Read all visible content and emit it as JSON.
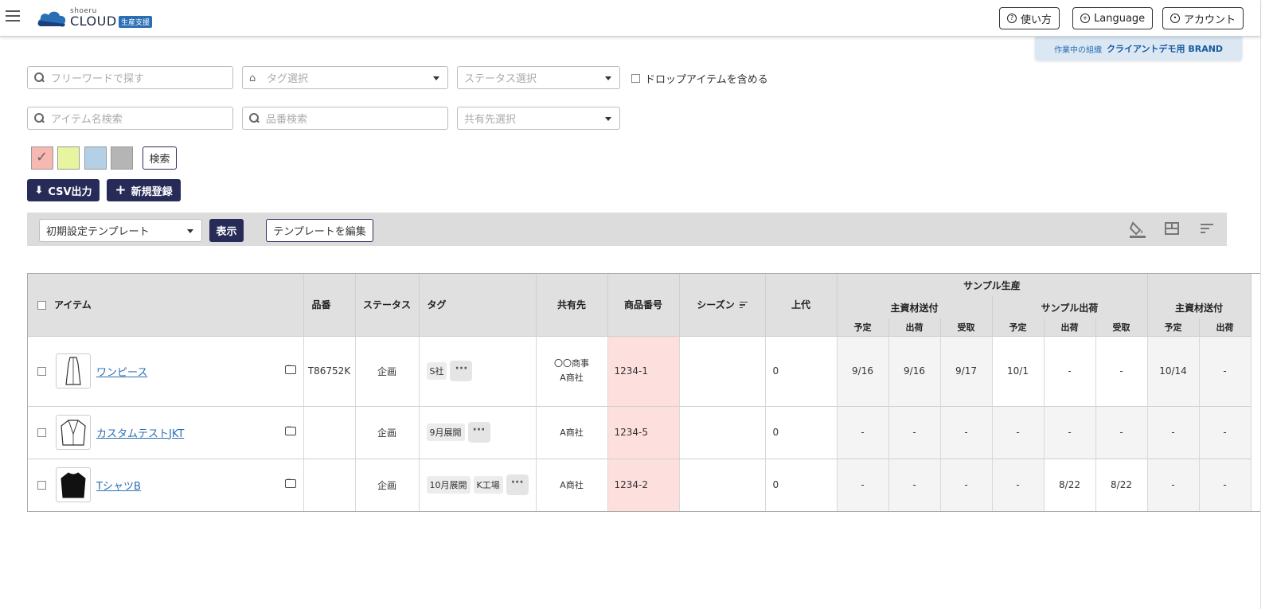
{
  "header": {
    "logo_small": "shoeru",
    "logo_big": "CLOUD",
    "logo_tag": "生産支援",
    "help_label": "使い方",
    "language_label": "Language",
    "account_label": "アカウント"
  },
  "org": {
    "prefix": "作業中の組織",
    "name": "クライアントデモ用 BRAND"
  },
  "filters": {
    "freeword_placeholder": "フリーワードで探す",
    "tag_placeholder": "タグ選択",
    "status_placeholder": "ステータス選択",
    "drop_label": "ドロップアイテムを含める",
    "itemname_placeholder": "アイテム名検索",
    "partno_placeholder": "品番検索",
    "share_placeholder": "共有先選択",
    "search_label": "検索",
    "swatches": [
      "#f7b8b1",
      "#e8f5a0",
      "#b4d0e6",
      "#b5b5b5"
    ]
  },
  "actions": {
    "csv_label": "CSV出力",
    "new_label": "新規登録"
  },
  "toolbar": {
    "template_value": "初期設定テンプレート",
    "show_label": "表示",
    "edit_template_label": "テンプレートを編集"
  },
  "table": {
    "headers": {
      "item": "アイテム",
      "partno": "品番",
      "status": "ステータス",
      "tag": "タグ",
      "share": "共有先",
      "product_no": "商品番号",
      "season": "シーズン",
      "retail": "上代",
      "sample_production": "サンプル生産",
      "main_material": "主資材送付",
      "sample_ship": "サンプル出荷",
      "main_material2": "主資材送付",
      "plan": "予定",
      "ship": "出荷",
      "receive": "受取"
    },
    "rows": [
      {
        "name": "ワンピース",
        "partno": "T86752K",
        "status": "企画",
        "tags": [
          "S社"
        ],
        "share_line1": "〇〇商事",
        "share_line2": "A商社",
        "product_no": "1234-1",
        "season": "",
        "retail": "0",
        "cells": [
          "9/16",
          "9/16",
          "9/17",
          "10/1",
          "-",
          "-",
          "10/14",
          "-"
        ]
      },
      {
        "name": "カスタムテストJKT",
        "partno": "",
        "status": "企画",
        "tags": [
          "9月展開"
        ],
        "share_line1": "A商社",
        "share_line2": "",
        "product_no": "1234-5",
        "season": "",
        "retail": "0",
        "cells": [
          "-",
          "-",
          "-",
          "-",
          "-",
          "-",
          "-",
          "-"
        ]
      },
      {
        "name": "TシャツB",
        "partno": "",
        "status": "企画",
        "tags": [
          "10月展開",
          "K工場"
        ],
        "share_line1": "A商社",
        "share_line2": "",
        "product_no": "1234-2",
        "season": "",
        "retail": "0",
        "cells": [
          "-",
          "-",
          "-",
          "-",
          "8/22",
          "8/22",
          "-",
          "-"
        ]
      }
    ]
  }
}
